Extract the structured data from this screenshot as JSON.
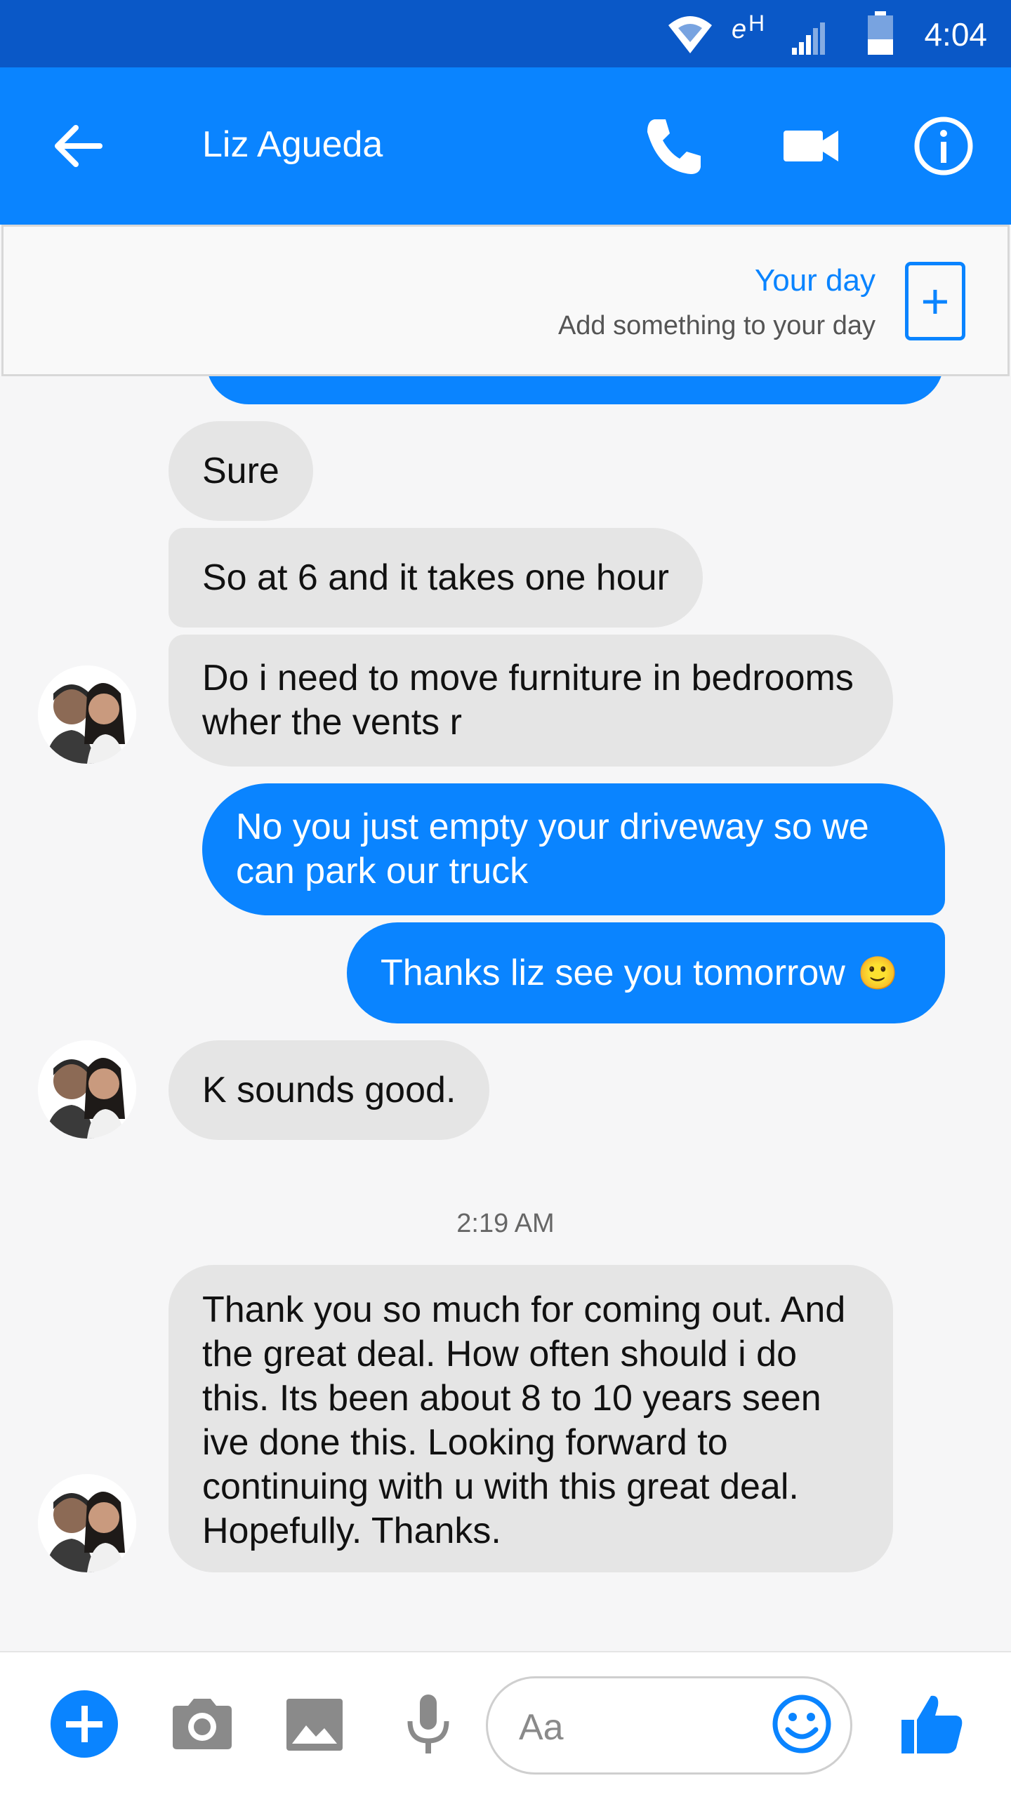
{
  "status_bar": {
    "time": "4:04",
    "network": "H",
    "icons": [
      "wifi-icon",
      "data-h-icon",
      "signal-icon",
      "battery-icon"
    ]
  },
  "header": {
    "contact_name": "Liz Agueda",
    "icons": [
      "back-arrow-icon",
      "phone-icon",
      "video-camera-icon",
      "info-icon"
    ]
  },
  "your_day": {
    "title": "Your day",
    "subtitle": "Add something to your day",
    "add_symbol": "+"
  },
  "messages": [
    {
      "direction": "incoming",
      "text": "Sure"
    },
    {
      "direction": "incoming",
      "text": "So at 6 and it takes one hour"
    },
    {
      "direction": "incoming",
      "text": "Do i need to move furniture in bedrooms wher the vents r"
    },
    {
      "direction": "outgoing",
      "text": "No you just empty your driveway so we can park our truck"
    },
    {
      "direction": "outgoing",
      "text": "Thanks liz see you tomorrow",
      "emoji": "🙂"
    },
    {
      "direction": "incoming",
      "text": "K sounds good."
    },
    {
      "direction": "timestamp",
      "text": "2:19 AM"
    },
    {
      "direction": "incoming",
      "text": "Thank you so much for coming out. And the great deal. How often should i do this. Its been about 8 to 10 years seen ive done this.  Looking forward to continuing with u with this great deal. Hopefully. Thanks."
    }
  ],
  "composer": {
    "placeholder": "Aa",
    "icons": [
      "plus-icon",
      "camera-icon",
      "image-icon",
      "microphone-icon",
      "emoji-icon",
      "thumbs-up-icon"
    ]
  },
  "colors": {
    "status_bar": "#0a58c7",
    "brand_blue": "#0a84ff",
    "incoming_bubble": "#e5e5e5",
    "background": "#f6f6f7"
  }
}
